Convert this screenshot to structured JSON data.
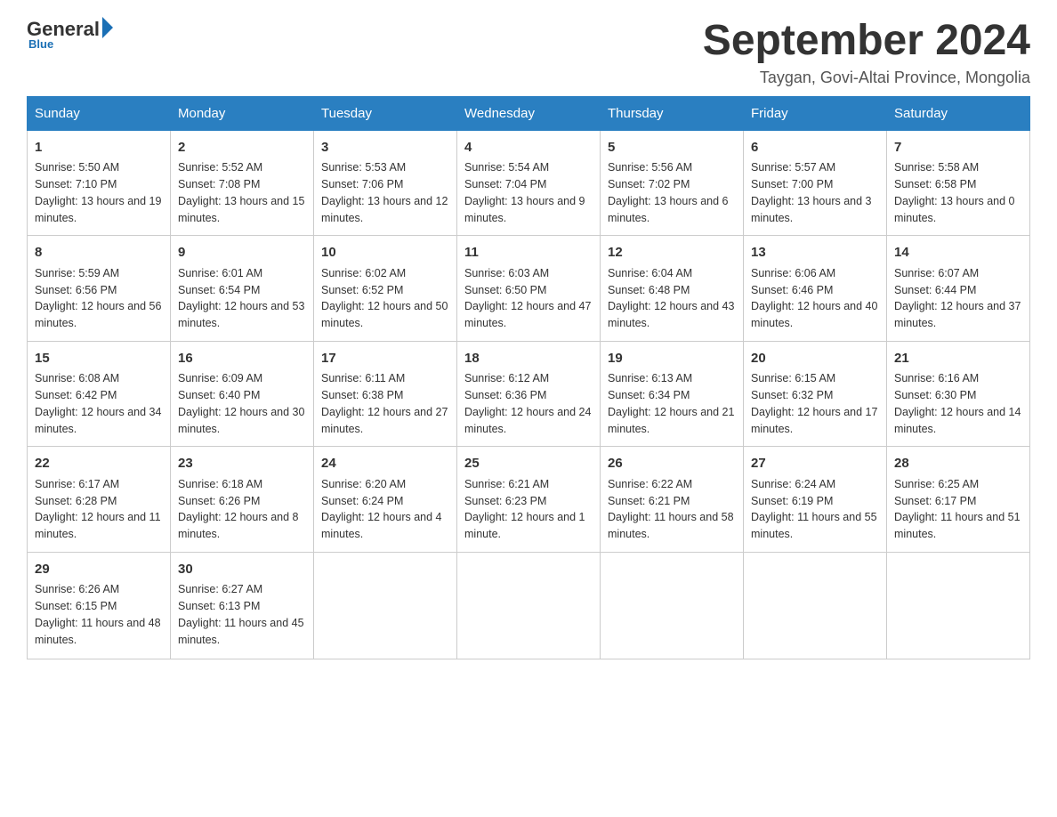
{
  "header": {
    "logo_general": "General",
    "logo_blue": "Blue",
    "month_title": "September 2024",
    "location": "Taygan, Govi-Altai Province, Mongolia"
  },
  "weekdays": [
    "Sunday",
    "Monday",
    "Tuesday",
    "Wednesday",
    "Thursday",
    "Friday",
    "Saturday"
  ],
  "weeks": [
    [
      {
        "day": "1",
        "sunrise": "5:50 AM",
        "sunset": "7:10 PM",
        "daylight": "13 hours and 19 minutes."
      },
      {
        "day": "2",
        "sunrise": "5:52 AM",
        "sunset": "7:08 PM",
        "daylight": "13 hours and 15 minutes."
      },
      {
        "day": "3",
        "sunrise": "5:53 AM",
        "sunset": "7:06 PM",
        "daylight": "13 hours and 12 minutes."
      },
      {
        "day": "4",
        "sunrise": "5:54 AM",
        "sunset": "7:04 PM",
        "daylight": "13 hours and 9 minutes."
      },
      {
        "day": "5",
        "sunrise": "5:56 AM",
        "sunset": "7:02 PM",
        "daylight": "13 hours and 6 minutes."
      },
      {
        "day": "6",
        "sunrise": "5:57 AM",
        "sunset": "7:00 PM",
        "daylight": "13 hours and 3 minutes."
      },
      {
        "day": "7",
        "sunrise": "5:58 AM",
        "sunset": "6:58 PM",
        "daylight": "13 hours and 0 minutes."
      }
    ],
    [
      {
        "day": "8",
        "sunrise": "5:59 AM",
        "sunset": "6:56 PM",
        "daylight": "12 hours and 56 minutes."
      },
      {
        "day": "9",
        "sunrise": "6:01 AM",
        "sunset": "6:54 PM",
        "daylight": "12 hours and 53 minutes."
      },
      {
        "day": "10",
        "sunrise": "6:02 AM",
        "sunset": "6:52 PM",
        "daylight": "12 hours and 50 minutes."
      },
      {
        "day": "11",
        "sunrise": "6:03 AM",
        "sunset": "6:50 PM",
        "daylight": "12 hours and 47 minutes."
      },
      {
        "day": "12",
        "sunrise": "6:04 AM",
        "sunset": "6:48 PM",
        "daylight": "12 hours and 43 minutes."
      },
      {
        "day": "13",
        "sunrise": "6:06 AM",
        "sunset": "6:46 PM",
        "daylight": "12 hours and 40 minutes."
      },
      {
        "day": "14",
        "sunrise": "6:07 AM",
        "sunset": "6:44 PM",
        "daylight": "12 hours and 37 minutes."
      }
    ],
    [
      {
        "day": "15",
        "sunrise": "6:08 AM",
        "sunset": "6:42 PM",
        "daylight": "12 hours and 34 minutes."
      },
      {
        "day": "16",
        "sunrise": "6:09 AM",
        "sunset": "6:40 PM",
        "daylight": "12 hours and 30 minutes."
      },
      {
        "day": "17",
        "sunrise": "6:11 AM",
        "sunset": "6:38 PM",
        "daylight": "12 hours and 27 minutes."
      },
      {
        "day": "18",
        "sunrise": "6:12 AM",
        "sunset": "6:36 PM",
        "daylight": "12 hours and 24 minutes."
      },
      {
        "day": "19",
        "sunrise": "6:13 AM",
        "sunset": "6:34 PM",
        "daylight": "12 hours and 21 minutes."
      },
      {
        "day": "20",
        "sunrise": "6:15 AM",
        "sunset": "6:32 PM",
        "daylight": "12 hours and 17 minutes."
      },
      {
        "day": "21",
        "sunrise": "6:16 AM",
        "sunset": "6:30 PM",
        "daylight": "12 hours and 14 minutes."
      }
    ],
    [
      {
        "day": "22",
        "sunrise": "6:17 AM",
        "sunset": "6:28 PM",
        "daylight": "12 hours and 11 minutes."
      },
      {
        "day": "23",
        "sunrise": "6:18 AM",
        "sunset": "6:26 PM",
        "daylight": "12 hours and 8 minutes."
      },
      {
        "day": "24",
        "sunrise": "6:20 AM",
        "sunset": "6:24 PM",
        "daylight": "12 hours and 4 minutes."
      },
      {
        "day": "25",
        "sunrise": "6:21 AM",
        "sunset": "6:23 PM",
        "daylight": "12 hours and 1 minute."
      },
      {
        "day": "26",
        "sunrise": "6:22 AM",
        "sunset": "6:21 PM",
        "daylight": "11 hours and 58 minutes."
      },
      {
        "day": "27",
        "sunrise": "6:24 AM",
        "sunset": "6:19 PM",
        "daylight": "11 hours and 55 minutes."
      },
      {
        "day": "28",
        "sunrise": "6:25 AM",
        "sunset": "6:17 PM",
        "daylight": "11 hours and 51 minutes."
      }
    ],
    [
      {
        "day": "29",
        "sunrise": "6:26 AM",
        "sunset": "6:15 PM",
        "daylight": "11 hours and 48 minutes."
      },
      {
        "day": "30",
        "sunrise": "6:27 AM",
        "sunset": "6:13 PM",
        "daylight": "11 hours and 45 minutes."
      },
      null,
      null,
      null,
      null,
      null
    ]
  ]
}
